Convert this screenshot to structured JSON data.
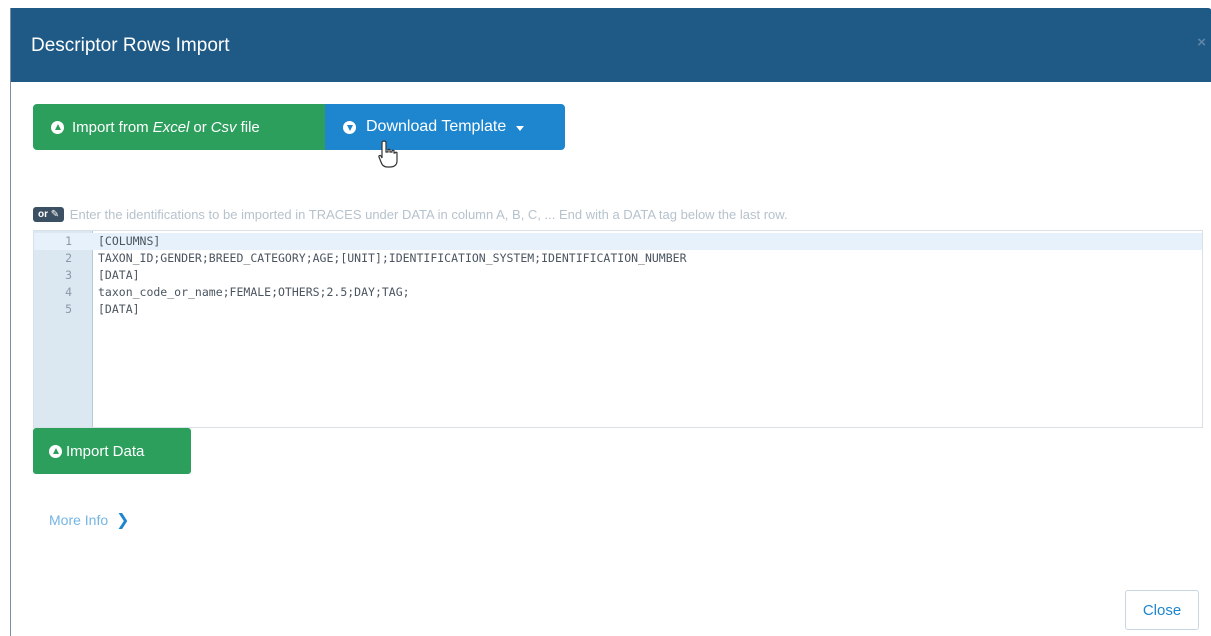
{
  "dialog": {
    "title": "Descriptor Rows Import",
    "close_glyph": "×"
  },
  "toolbar": {
    "import_file_label_prefix": "Import from ",
    "import_file_label_excel": "Excel",
    "import_file_label_or": " or ",
    "import_file_label_csv": "Csv",
    "import_file_label_suffix": " file",
    "download_template_label": "Download Template"
  },
  "hint": {
    "badge_text": "or ✎",
    "text": "Enter the identifications to be imported in TRACES under DATA in column A, B, C, ... End with a DATA tag below the last row."
  },
  "editor": {
    "lines": [
      {
        "number": "1",
        "content": "[COLUMNS]"
      },
      {
        "number": "2",
        "content": "TAXON_ID;GENDER;BREED_CATEGORY;AGE;[UNIT];IDENTIFICATION_SYSTEM;IDENTIFICATION_NUMBER"
      },
      {
        "number": "3",
        "content": "[DATA]"
      },
      {
        "number": "4",
        "content": "taxon_code_or_name;FEMALE;OTHERS;2.5;DAY;TAG;"
      },
      {
        "number": "5",
        "content": "[DATA]"
      }
    ]
  },
  "actions": {
    "import_data_label": "Import Data",
    "more_info_label": "More Info",
    "close_label": "Close"
  },
  "colors": {
    "header_bg": "#1f5a86",
    "success_green": "#2c9f5d",
    "primary_blue": "#1d86cf"
  }
}
